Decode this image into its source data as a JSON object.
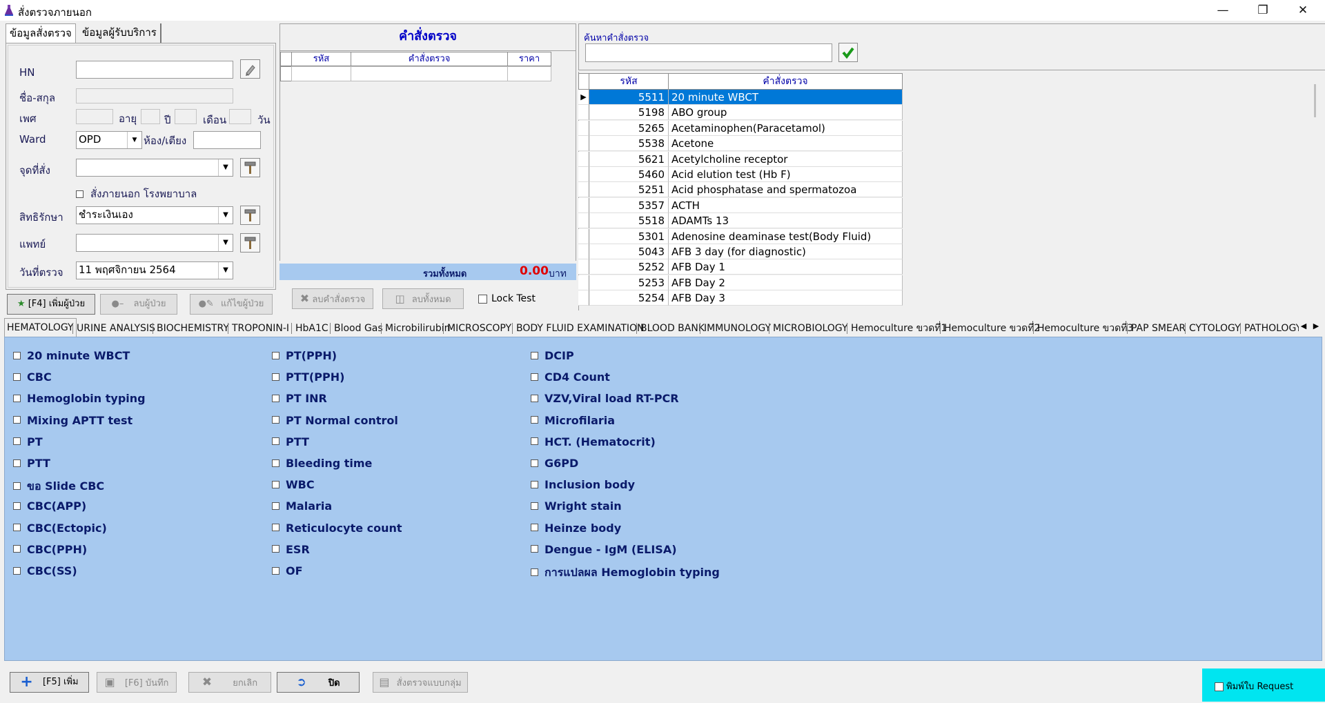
{
  "window": {
    "title": "สั่งตรวจภายนอก"
  },
  "left_tabs": [
    "ข้อมูลสั่งตรวจ",
    "ข้อมูลผู้รับบริการ"
  ],
  "patient_form": {
    "hn_label": "HN",
    "name_label": "ชื่อ-สกุล",
    "sex_label": "เพศ",
    "age_label": "อายุ",
    "year_label": "ปี",
    "month_label": "เดือน",
    "day_label": "วัน",
    "ward_label": "Ward",
    "ward_value": "OPD",
    "room_label": "ห้อง/เตียง",
    "order_point_label": "จุดที่สั่ง",
    "external_order_label": "สั่งภายนอก โรงพยาบาล",
    "rights_label": "สิทธิรักษา",
    "rights_value": "ชำระเงินเอง",
    "doctor_label": "แพทย์",
    "date_label": "วันที่ตรวจ",
    "date_value": "11 พฤศจิกายน  2564"
  },
  "patient_buttons": {
    "add": "[F4] เพิ่มผู้ป่วย",
    "delete": "ลบผู้ป่วย",
    "edit": "แก้ไขผู้ป่วย"
  },
  "orders": {
    "title": "คำสั่งตรวจ",
    "columns": [
      "รหัส",
      "คำสั่งตรวจ",
      "ราคา"
    ],
    "total_label": "รวมทั้งหมด",
    "total_value": "0.00",
    "currency": "บาท",
    "delete_order_button": "ลบคำสั่งตรวจ",
    "delete_all_button": "ลบทั้งหมด",
    "lock_test_label": "Lock Test"
  },
  "search": {
    "label": "ค้นหาคำสั่งตรวจ",
    "value": "",
    "columns": [
      "รหัส",
      "คำสั่งตรวจ"
    ],
    "rows": [
      {
        "code": "5511",
        "name": "20 minute WBCT",
        "selected": true
      },
      {
        "code": "5198",
        "name": "ABO group"
      },
      {
        "code": "5265",
        "name": "Acetaminophen(Paracetamol)"
      },
      {
        "code": "5538",
        "name": "Acetone"
      },
      {
        "code": "5621",
        "name": "Acetylcholine receptor"
      },
      {
        "code": "5460",
        "name": "Acid elution test (Hb F)"
      },
      {
        "code": "5251",
        "name": "Acid phosphatase and spermatozoa"
      },
      {
        "code": "5357",
        "name": "ACTH"
      },
      {
        "code": "5518",
        "name": "ADAMTs 13"
      },
      {
        "code": "5301",
        "name": "Adenosine deaminase test(Body Fluid)"
      },
      {
        "code": "5043",
        "name": "AFB 3 day (for diagnostic)"
      },
      {
        "code": "5252",
        "name": "AFB Day 1"
      },
      {
        "code": "5253",
        "name": "AFB Day 2"
      },
      {
        "code": "5254",
        "name": "AFB Day 3"
      }
    ]
  },
  "category_tabs": [
    "HEMATOLOGY",
    "URINE ANALYSIS",
    "BIOCHEMISTRY",
    "TROPONIN-I",
    "HbA1C",
    "Blood Gas",
    "Microbilirubin",
    "MICROSCOPY",
    "BODY FLUID EXAMINATION",
    "BLOOD BANK",
    "IMMUNOLOGY",
    "MICROBIOLOGY",
    "Hemoculture ขวดที่1",
    "Hemoculture ขวดที่2",
    "Hemoculture ขวดที่3",
    "PAP SMEAR",
    "CYTOLOGY",
    "PATHOLOGY"
  ],
  "active_category": "HEMATOLOGY",
  "tests": {
    "col1": [
      "20 minute WBCT",
      "CBC",
      "Hemoglobin typing",
      "Mixing APTT test",
      "PT",
      "PTT",
      "ขอ Slide CBC",
      "CBC(APP)",
      "CBC(Ectopic)",
      "CBC(PPH)",
      "CBC(SS)"
    ],
    "col2": [
      "PT(PPH)",
      "PTT(PPH)",
      "PT INR",
      "PT Normal control",
      "PTT",
      "Bleeding time",
      "WBC",
      "Malaria",
      "Reticulocyte count",
      "ESR",
      "OF"
    ],
    "col3": [
      "DCIP",
      "CD4 Count",
      "VZV,Viral load RT-PCR",
      "Microfilaria",
      "HCT. (Hematocrit)",
      "G6PD",
      "Inclusion body",
      "Wright stain",
      "Heinze body",
      "Dengue  - IgM (ELISA)",
      "การแปลผล Hemoglobin typing"
    ]
  },
  "bottom_toolbar": {
    "add": "[F5] เพิ่ม",
    "save": "[F6] บันทึก",
    "cancel": "ยกเลิก",
    "close": "ปิด",
    "group_order": "สั่งตรวจแบบกลุ่ม",
    "print_request": "พิมพ์ใบ Request"
  },
  "colors": {
    "test_panel_bg": "#a7c9ef",
    "selection": "#0078d7",
    "print_area": "#00e5f0",
    "total_bar": "#a7c9ef"
  }
}
